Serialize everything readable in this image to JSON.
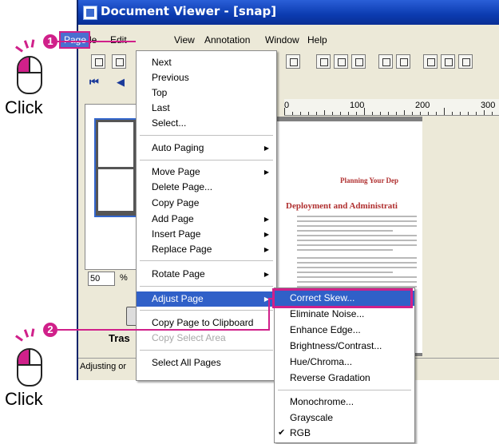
{
  "window": {
    "title": "Document Viewer - [snap]",
    "menu": [
      "File",
      "Edit",
      "Page",
      "View",
      "Annotation",
      "Window",
      "Help"
    ],
    "status_text": "Adjusting or",
    "zoom_value": "50",
    "zoom_unit": "%",
    "trash_label": "Tras",
    "ruler": [
      "0",
      "100",
      "200",
      "300"
    ]
  },
  "document": {
    "heading1": "Planning Your Dep",
    "heading2": "Deployment and Administrati"
  },
  "page_menu": {
    "items": [
      {
        "label": "Next"
      },
      {
        "label": "Previous"
      },
      {
        "label": "Top"
      },
      {
        "label": "Last"
      },
      {
        "label": "Select..."
      },
      {
        "label": "Auto Paging"
      },
      {
        "label": "Move Page"
      },
      {
        "label": "Delete Page..."
      },
      {
        "label": "Copy Page"
      },
      {
        "label": "Add Page"
      },
      {
        "label": "Insert Page"
      },
      {
        "label": "Replace Page"
      },
      {
        "label": "Rotate Page"
      },
      {
        "label": "Adjust Page"
      },
      {
        "label": "Copy Page to Clipboard"
      },
      {
        "label": "Copy Select Area"
      },
      {
        "label": "Select All Pages"
      }
    ]
  },
  "adjust_submenu": {
    "items": [
      {
        "label": "Correct Skew..."
      },
      {
        "label": "Eliminate Noise..."
      },
      {
        "label": "Enhance Edge..."
      },
      {
        "label": "Brightness/Contrast..."
      },
      {
        "label": "Hue/Chroma..."
      },
      {
        "label": "Reverse Gradation"
      },
      {
        "label": "Monochrome..."
      },
      {
        "label": "Grayscale"
      },
      {
        "label": "RGB"
      }
    ]
  },
  "callouts": [
    {
      "number": "1",
      "label": "Click"
    },
    {
      "number": "2",
      "label": "Click"
    }
  ],
  "colors": {
    "accent": "#d0208a",
    "highlight": "#3060c8",
    "titlebar": "#0b3bb0"
  }
}
